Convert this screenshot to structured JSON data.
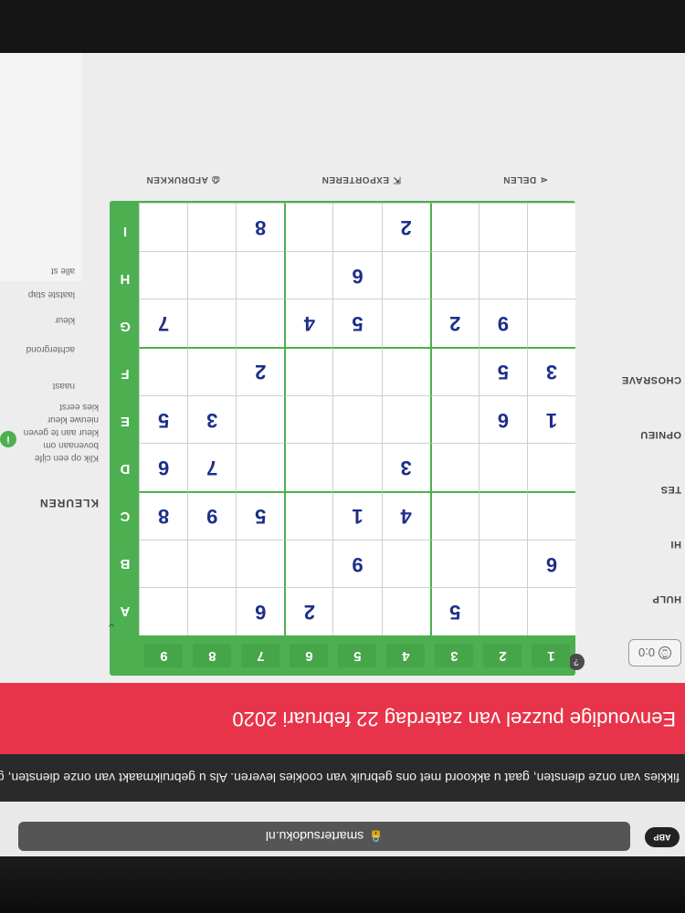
{
  "browser": {
    "privacy_badge": "ABP",
    "url": "smartersudoku.nl",
    "lock_icon": "lock-icon"
  },
  "cookie_notice": "fikkies van onze diensten, gaat u akkoord met ons gebruik van cookies leveren. Als u gebruikmaakt van onze diensten, gaat u akkoord met ons gebruik van cook",
  "banner": {
    "title": "Eenvoudige puzzel van zaterdag 22 februari 2020"
  },
  "timer": {
    "value": "0:0",
    "icon": "clock-icon"
  },
  "board": {
    "col_labels": [
      "1",
      "2",
      "3",
      "4",
      "5",
      "6",
      "7",
      "8",
      "9"
    ],
    "row_labels": [
      "A",
      "B",
      "C",
      "D",
      "E",
      "F",
      "G",
      "H",
      "I"
    ],
    "help_icon": "question-icon",
    "cells": [
      [
        "",
        "",
        "5",
        "",
        "",
        "2",
        "6",
        "",
        ""
      ],
      [
        "6",
        "",
        "",
        "",
        "9",
        "",
        "",
        "",
        ""
      ],
      [
        "",
        "",
        "",
        "4",
        "1",
        "",
        "5",
        "9",
        "8"
      ],
      [
        "",
        "",
        "",
        "3",
        "",
        "",
        "",
        "7",
        "6"
      ],
      [
        "1",
        "6",
        "",
        "",
        "",
        "",
        "",
        "3",
        "5"
      ],
      [
        "3",
        "5",
        "",
        "",
        "",
        "",
        "2",
        "",
        ""
      ],
      [
        "",
        "9",
        "2",
        "",
        "5",
        "4",
        "",
        "",
        "7"
      ],
      [
        "",
        "",
        "",
        "",
        "6",
        "",
        "",
        "",
        ""
      ],
      [
        "",
        "",
        "",
        "2",
        "",
        "",
        "8",
        "",
        ""
      ]
    ]
  },
  "toolbar": {
    "share": "DELEN",
    "share_icon": "share-icon",
    "export": "EXPORTEREN",
    "export_icon": "export-icon",
    "print": "AFDRUKKEN",
    "print_icon": "printer-icon"
  },
  "side_menu": {
    "item1": "HULP",
    "item2": "HI",
    "item3": "TES",
    "item4": "OPNIEU",
    "item5": "CHOSRAVE"
  },
  "clues": {
    "title": "KLEUREN",
    "badge": "i",
    "line1": "Klik op een cijfe",
    "line2": "bovenaan om",
    "line3": "kleur aan te geven",
    "line4": "nieuwe kleur",
    "line5": "kies eerst"
  },
  "right_list": {
    "a": "naast",
    "b": "achtergrond",
    "c": "kleur",
    "d": "laatste stap",
    "e": "alle st"
  }
}
